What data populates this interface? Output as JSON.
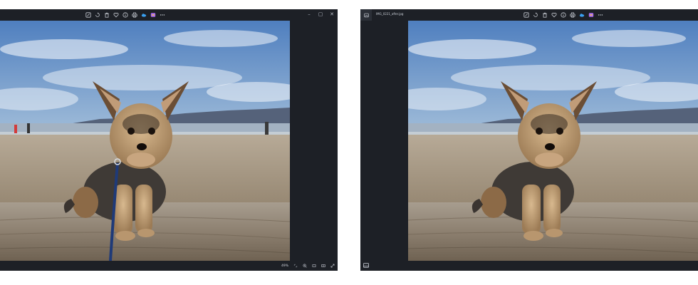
{
  "left_window": {
    "toolbar_icons": [
      "edit-icon",
      "rotate-icon",
      "delete-icon",
      "favorite-icon",
      "info-icon",
      "print-icon",
      "onedrive-icon",
      "clipchamp-icon",
      "more-icon"
    ],
    "window_controls": [
      "–",
      "▢",
      "✕"
    ],
    "zoom_percent": "49%",
    "status_icons": [
      "fit-icon",
      "zoom-in-icon",
      "view-icon",
      "compare-icon",
      "fullscreen-icon"
    ]
  },
  "right_window": {
    "filename": "IMG_0221_after.jpg",
    "toolbar_icons": [
      "edit-icon",
      "rotate-icon",
      "delete-icon",
      "favorite-icon",
      "info-icon",
      "print-icon",
      "onedrive-icon",
      "clipchamp-icon",
      "more-icon"
    ]
  },
  "colors": {
    "chrome": "#1d2026",
    "onedrive": "#3aa0f0",
    "clipchamp": "#a86bf0",
    "icon": "#c5c9d1"
  }
}
